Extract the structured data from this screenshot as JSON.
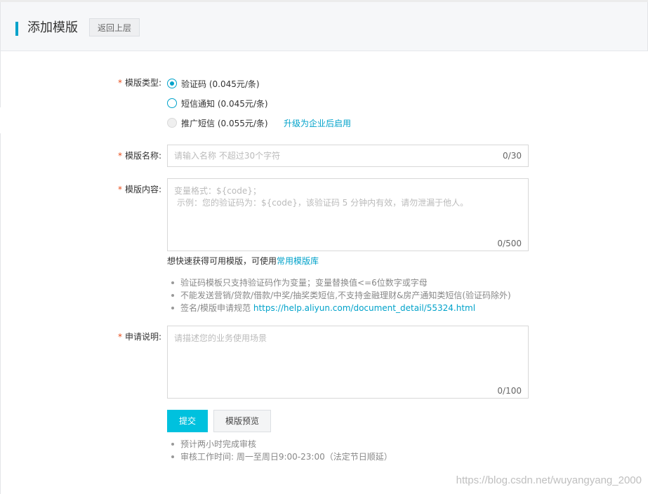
{
  "header": {
    "title": "添加模版",
    "back_label": "返回上层"
  },
  "form": {
    "type": {
      "label": "模版类型:",
      "options": [
        {
          "label": "验证码 (0.045元/条)",
          "state": "checked"
        },
        {
          "label": "短信通知 (0.045元/条)",
          "state": "unchecked"
        },
        {
          "label": "推广短信 (0.055元/条)",
          "state": "disabled"
        }
      ],
      "upgrade_link": "升级为企业后启用"
    },
    "name": {
      "label": "模版名称:",
      "placeholder": "请输入名称 不超过30个字符",
      "counter": "0/30"
    },
    "content": {
      "label": "模版内容:",
      "placeholder_line1": "变量格式：${code}；",
      "placeholder_line2": "示例：您的验证码为：${code}，该验证码 5 分钟内有效，请勿泄漏于他人。",
      "counter": "0/500"
    },
    "quick_hint": {
      "text": "想快速获得可用模版，可使用",
      "link": "常用模版库"
    },
    "tips": [
      "验证码模板只支持验证码作为变量；变量替换值<=6位数字或字母",
      "不能发送营销/贷款/借款/中奖/抽奖类短信,不支持金融理财&房产通知类短信(验证码除外)"
    ],
    "tip_sign": {
      "text": "签名/模版申请规范 ",
      "link": "https://help.aliyun.com/document_detail/55324.html"
    },
    "description": {
      "label": "申请说明:",
      "placeholder": "请描述您的业务使用场景",
      "counter": "0/100"
    },
    "required_mark": "*",
    "submit_label": "提交",
    "preview_label": "模版预览",
    "review_notes": [
      "预计两小时完成审核",
      "审核工作时间: 周一至周日9:00-23:00（法定节日顺延）"
    ]
  },
  "watermark": "https://blog.csdn.net/wuyangyang_2000",
  "colors": {
    "accent": "#00a2ca",
    "primary_button": "#00c1de",
    "required": "#e84d1c"
  }
}
